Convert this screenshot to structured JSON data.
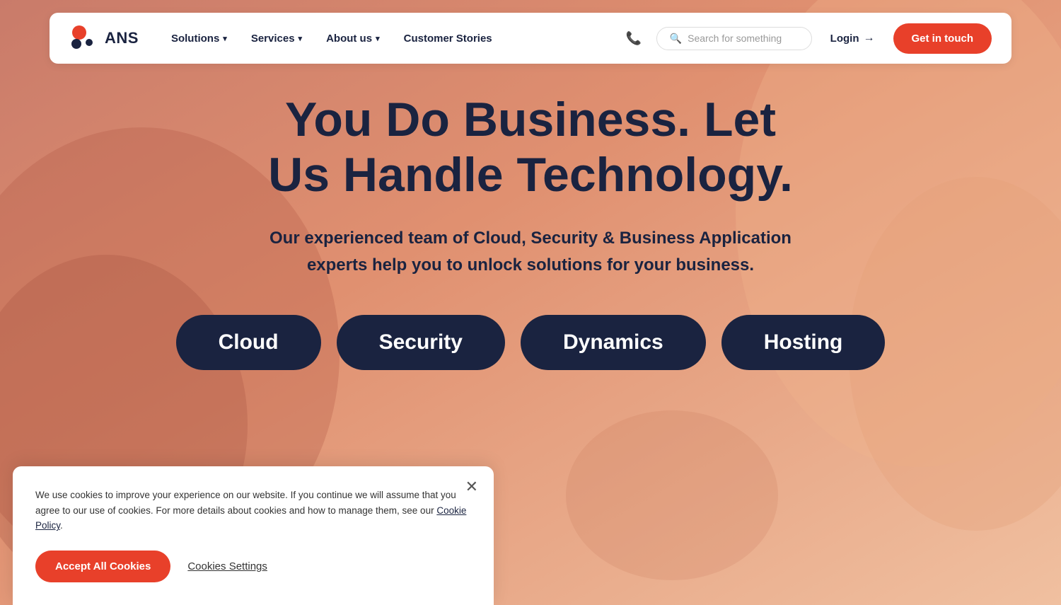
{
  "brand": {
    "name": "ANS"
  },
  "nav": {
    "solutions_label": "Solutions",
    "services_label": "Services",
    "about_label": "About us",
    "customer_stories_label": "Customer Stories",
    "search_placeholder": "Search for something",
    "login_label": "Login",
    "get_in_touch_label": "Get in touch"
  },
  "hero": {
    "title_line1": "You Do Business. Let",
    "title_line2": "Us Handle Technology.",
    "subtitle": "Our experienced team of Cloud, Security & Business Application experts help you to unlock solutions for your business.",
    "categories": [
      {
        "label": "Cloud"
      },
      {
        "label": "Security"
      },
      {
        "label": "Dynamics"
      },
      {
        "label": "Hosting"
      }
    ]
  },
  "cookie_banner": {
    "message_part1": "We use cookies to improve your experience on our website. If you continue we will assume that you agree to our use of cookies. For more details about cookies and how to manage them, see our ",
    "cookie_policy_link": "Cookie Policy",
    "message_part2": ".",
    "accept_label": "Accept All Cookies",
    "settings_label": "Cookies Settings"
  },
  "colors": {
    "brand_dark": "#1a2340",
    "accent_red": "#e8402a",
    "bg_gradient_start": "#d4826a",
    "bg_gradient_end": "#e8b090"
  }
}
